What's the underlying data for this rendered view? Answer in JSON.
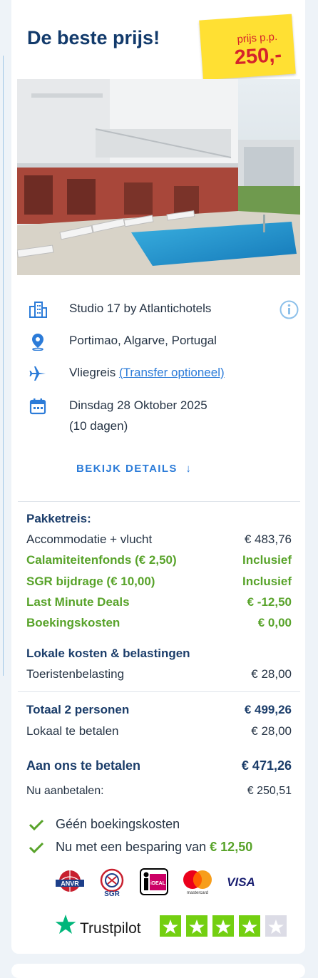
{
  "header": {
    "title": "De beste prijs!"
  },
  "price_sticker": {
    "label": "prijs p.p.",
    "amount": "250,-"
  },
  "hotel": {
    "name": "Studio 17 by Atlantichotels",
    "location": "Portimao, Algarve, Portugal",
    "travel_type": "Vliegreis",
    "transfer_link": "(Transfer optioneel)",
    "date": "Dinsdag 28 Oktober 2025",
    "duration": "(10 dagen)",
    "details_label": "BEKIJK DETAILS"
  },
  "breakdown": {
    "package_heading": "Pakketreis:",
    "lines": [
      {
        "label": "Accommodatie + vlucht",
        "value": "€ 483,76",
        "style": "normal"
      },
      {
        "label": "Calamiteitenfonds (€ 2,50)",
        "value": "Inclusief",
        "style": "green"
      },
      {
        "label": "SGR bijdrage (€ 10,00)",
        "value": "Inclusief",
        "style": "green"
      },
      {
        "label": "Last Minute Deals",
        "value": "€ -12,50",
        "style": "green"
      },
      {
        "label": "Boekingskosten",
        "value": "€ 0,00",
        "style": "green"
      }
    ],
    "local_heading": "Lokale kosten & belastingen",
    "tourist_tax_label": "Toeristenbelasting",
    "tourist_tax_value": "€ 28,00"
  },
  "totals": {
    "total_label": "Totaal 2 personen",
    "total_value": "€ 499,26",
    "local_pay_label": "Lokaal te betalen",
    "local_pay_value": "€ 28,00",
    "pay_us_label": "Aan ons te betalen",
    "pay_us_value": "€ 471,26",
    "deposit_label": "Nu aanbetalen:",
    "deposit_value": "€ 250,51"
  },
  "benefits": {
    "no_fees": "Géén boekingskosten",
    "saving_prefix": "Nu met een besparing van",
    "saving_amount": "€ 12,50"
  },
  "payment_logos": {
    "anvr": "ANVR",
    "sgr": "SGR",
    "ideal": "iDEAL",
    "mastercard": "mastercard",
    "visa": "VISA"
  },
  "trustpilot": {
    "brand": "Trustpilot",
    "rating_stars": 4,
    "max_stars": 5
  },
  "colors": {
    "navy": "#123a6b",
    "green": "#58a32a",
    "accent_blue": "#2b7bd8",
    "sticker_yellow": "#ffe033",
    "price_red": "#d5232b",
    "trustpilot_green": "#73cf11"
  }
}
